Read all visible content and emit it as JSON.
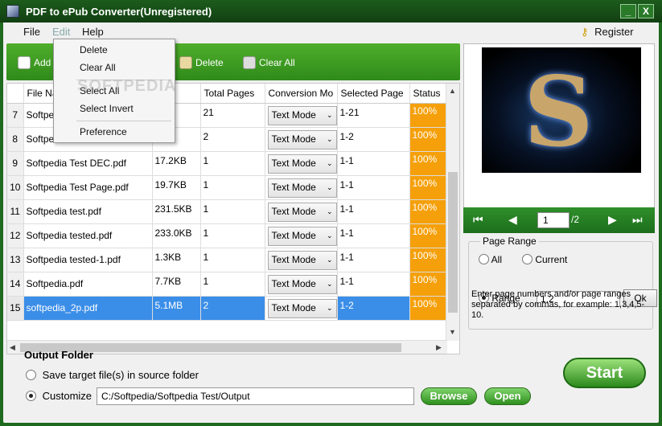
{
  "window": {
    "title": "PDF to ePub Converter(Unregistered)",
    "minimize": "_",
    "close": "X"
  },
  "menu": {
    "file": "File",
    "edit": "Edit",
    "help": "Help",
    "register": "Register"
  },
  "edit_menu": {
    "delete": "Delete",
    "clear_all": "Clear All",
    "select_all": "Select All",
    "select_invert": "Select Invert",
    "preference": "Preference"
  },
  "toolbar": {
    "add": "Add",
    "delete": "Delete",
    "clear_all": "Clear All"
  },
  "table": {
    "columns": [
      "File Na",
      "",
      "Total Pages",
      "Conversion Mo",
      "Selected Page",
      "Status"
    ],
    "rows": [
      {
        "n": "7",
        "name": "Softpe",
        "size": "KB",
        "pages": "21",
        "mode": "Text Mode",
        "sel": "1-21",
        "status": "100%"
      },
      {
        "n": "8",
        "name": "Softpe",
        "size": "KB",
        "pages": "2",
        "mode": "Text Mode",
        "sel": "1-2",
        "status": "100%"
      },
      {
        "n": "9",
        "name": "Softpedia Test DEC.pdf",
        "size": "17.2KB",
        "pages": "1",
        "mode": "Text Mode",
        "sel": "1-1",
        "status": "100%"
      },
      {
        "n": "10",
        "name": "Softpedia Test Page.pdf",
        "size": "19.7KB",
        "pages": "1",
        "mode": "Text Mode",
        "sel": "1-1",
        "status": "100%"
      },
      {
        "n": "11",
        "name": "Softpedia test.pdf",
        "size": "231.5KB",
        "pages": "1",
        "mode": "Text Mode",
        "sel": "1-1",
        "status": "100%"
      },
      {
        "n": "12",
        "name": "Softpedia tested.pdf",
        "size": "233.0KB",
        "pages": "1",
        "mode": "Text Mode",
        "sel": "1-1",
        "status": "100%"
      },
      {
        "n": "13",
        "name": "Softpedia tested-1.pdf",
        "size": "1.3KB",
        "pages": "1",
        "mode": "Text Mode",
        "sel": "1-1",
        "status": "100%"
      },
      {
        "n": "14",
        "name": "Softpedia.pdf",
        "size": "7.7KB",
        "pages": "1",
        "mode": "Text Mode",
        "sel": "1-1",
        "status": "100%"
      },
      {
        "n": "15",
        "name": "softpedia_2p.pdf",
        "size": "5.1MB",
        "pages": "2",
        "mode": "Text Mode",
        "sel": "1-2",
        "status": "100%"
      }
    ]
  },
  "preview": {
    "page": "1",
    "total": "/2"
  },
  "page_range": {
    "legend": "Page Range",
    "all": "All",
    "current": "Current",
    "range": "Range",
    "range_value": "1,2",
    "ok": "Ok",
    "hint": "Enter page numbers and/or page ranges separated by commas, for example: 1,3,4,5-10."
  },
  "output": {
    "title": "Output Folder",
    "save_source": "Save target file(s) in source folder",
    "customize": "Customize",
    "path": "C:/Softpedia/Softpedia Test/Output",
    "browse": "Browse",
    "open": "Open",
    "start": "Start"
  },
  "watermark": "SOFTPEDIA"
}
